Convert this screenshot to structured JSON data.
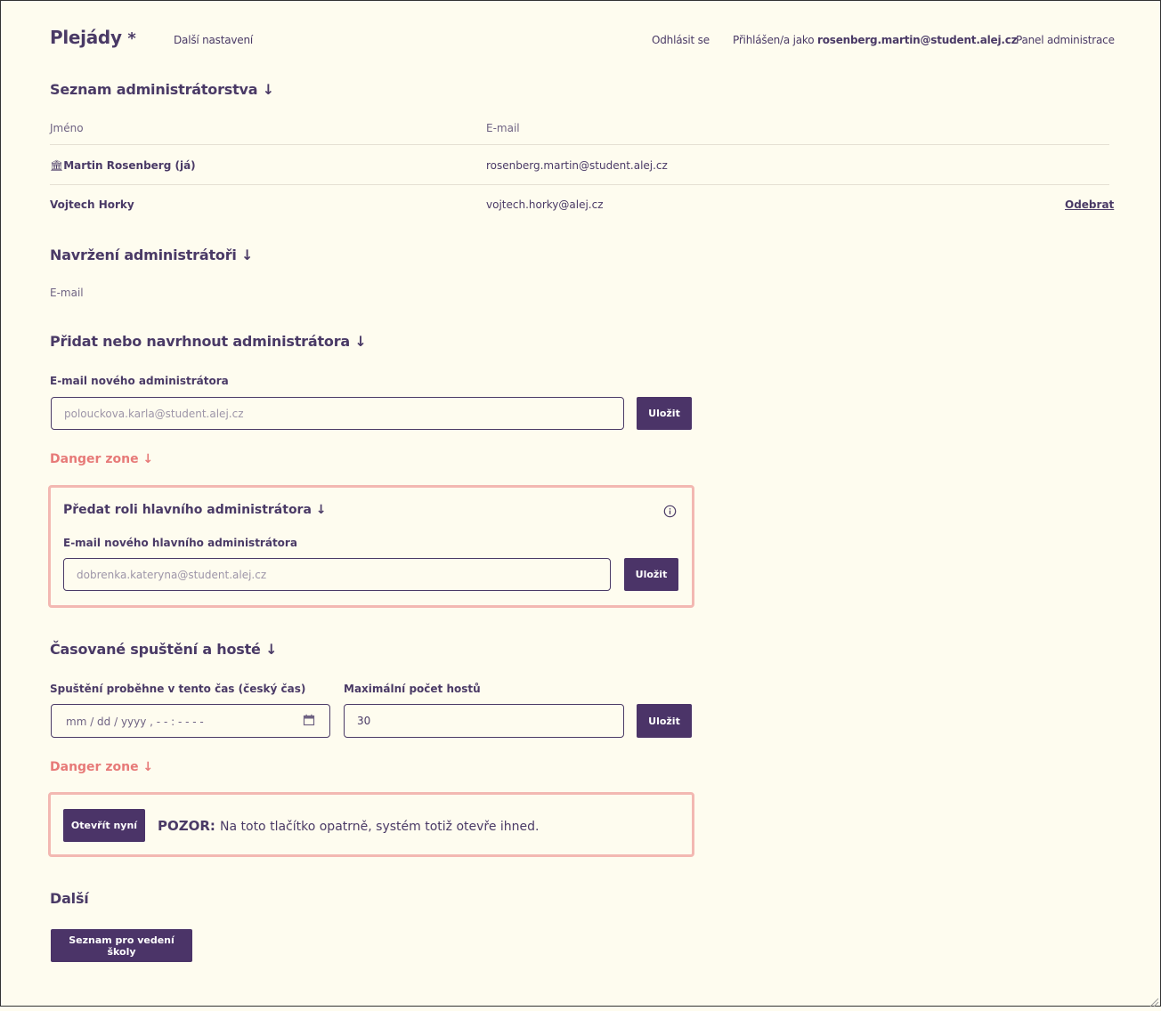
{
  "header": {
    "logo": "Plejády",
    "logo_mark": "*",
    "more_settings": "Další nastavení",
    "logout": "Odhlásit se",
    "logged_in_prefix": "Přihlášen/a jako",
    "logged_in_user": "rosenberg.martin@student.alej.cz",
    "admin_panel": "Panel administrace"
  },
  "admins": {
    "title": "Seznam administrátorstva ↓",
    "columns": {
      "name": "Jméno",
      "email": "E-mail"
    },
    "rows": [
      {
        "icon": "🏛",
        "name": "Martin Rosenberg (já)",
        "email": "rosenberg.martin@student.alej.cz",
        "action": ""
      },
      {
        "icon": "",
        "name": "Vojtech Horky",
        "email": "vojtech.horky@alej.cz",
        "action": "Odebrat"
      }
    ]
  },
  "proposed": {
    "title": "Navržení administrátoři ↓",
    "column_email": "E-mail"
  },
  "add_admin": {
    "title": "Přidat nebo navrhnout administrátora ↓",
    "label": "E-mail nového administrátora",
    "placeholder": "polouckova.karla@student.alej.cz",
    "value": "",
    "save": "Uložit"
  },
  "danger1": {
    "title": "Danger zone ↓",
    "box_title": "Předat roli hlavního administrátora ↓",
    "info_icon": "info-icon",
    "label": "E-mail nového hlavního administrátora",
    "placeholder": "dobrenka.kateryna@student.alej.cz",
    "value": "",
    "save": "Uložit"
  },
  "timed": {
    "title": "Časované spuštění a hosté ↓",
    "datetime_label": "Spuštění proběhne v tento čas (český čas)",
    "datetime_placeholder": "mm / dd / yyyy ,  - - : - -   - -",
    "calendar_icon": "calendar-icon",
    "guests_label": "Maximální počet hostů",
    "guests_value": "30",
    "save": "Uložit"
  },
  "danger2": {
    "title": "Danger zone ↓",
    "open_now": "Otevřít nyní",
    "warning_strong": "POZOR:",
    "warning_text": "Na toto tlačítko opatrně, systém totiž otevře ihned."
  },
  "other": {
    "title": "Další",
    "school_list_button": "Seznam pro vedení školy"
  },
  "colors": {
    "background": "#fefcef",
    "primary": "#4b3468",
    "danger_text": "#e77a78",
    "danger_border": "#f3b8b2"
  }
}
